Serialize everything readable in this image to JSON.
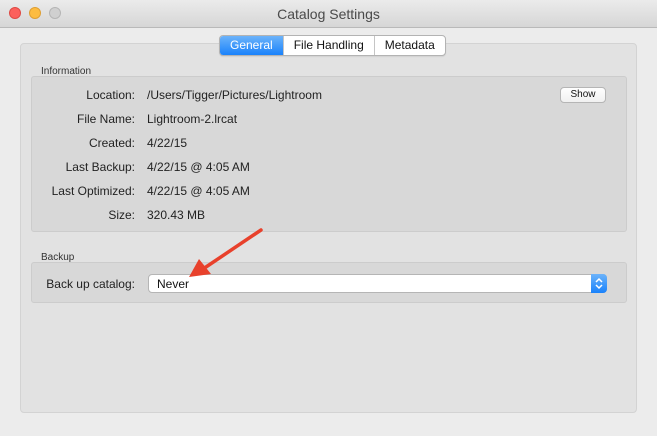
{
  "window": {
    "title": "Catalog Settings"
  },
  "tabs": [
    {
      "label": "General",
      "active": true
    },
    {
      "label": "File Handling",
      "active": false
    },
    {
      "label": "Metadata",
      "active": false
    }
  ],
  "information": {
    "heading": "Information",
    "rows": [
      {
        "label": "Location:",
        "value": "/Users/Tigger/Pictures/Lightroom"
      },
      {
        "label": "File Name:",
        "value": "Lightroom-2.lrcat"
      },
      {
        "label": "Created:",
        "value": "4/22/15"
      },
      {
        "label": "Last Backup:",
        "value": "4/22/15 @ 4:05 AM"
      },
      {
        "label": "Last Optimized:",
        "value": "4/22/15 @ 4:05 AM"
      },
      {
        "label": "Size:",
        "value": "320.43 MB"
      }
    ],
    "show_label": "Show"
  },
  "backup": {
    "heading": "Backup",
    "label": "Back up catalog:",
    "selected": "Never"
  },
  "colors": {
    "accent": "#1a82fb",
    "annotation_arrow": "#e8412c",
    "close": "#fc605c",
    "minimize": "#fdbc40",
    "zoom_inactive": "#d0d0d0"
  }
}
